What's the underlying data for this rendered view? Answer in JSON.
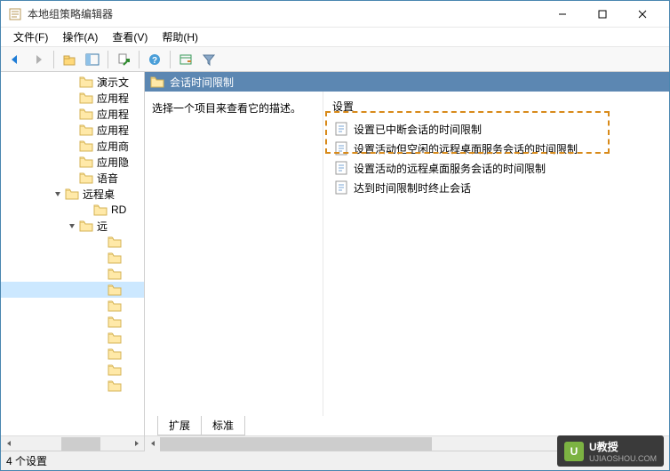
{
  "window": {
    "title": "本地组策略编辑器"
  },
  "menu": {
    "file": "文件(F)",
    "action": "操作(A)",
    "view": "查看(V)",
    "help": "帮助(H)"
  },
  "tree": {
    "items": [
      {
        "label": "演示文",
        "indent": 72
      },
      {
        "label": "应用程",
        "indent": 72
      },
      {
        "label": "应用程",
        "indent": 72
      },
      {
        "label": "应用程",
        "indent": 72
      },
      {
        "label": "应用商",
        "indent": 72
      },
      {
        "label": "应用隐",
        "indent": 72
      },
      {
        "label": "语音",
        "indent": 72
      },
      {
        "label": "远程桌",
        "indent": 56,
        "expander": "open"
      },
      {
        "label": "RD",
        "indent": 88
      },
      {
        "label": "远",
        "indent": 72,
        "expander": "open"
      },
      {
        "label": "",
        "indent": 104
      },
      {
        "label": "",
        "indent": 104
      },
      {
        "label": "",
        "indent": 104
      },
      {
        "label": "",
        "indent": 104,
        "selected": true
      },
      {
        "label": "",
        "indent": 104
      },
      {
        "label": "",
        "indent": 104
      },
      {
        "label": "",
        "indent": 104
      },
      {
        "label": "",
        "indent": 104
      },
      {
        "label": "",
        "indent": 104
      },
      {
        "label": "",
        "indent": 104
      }
    ]
  },
  "right": {
    "header": "会话时间限制",
    "desc": "选择一个项目来查看它的描述。",
    "settings_header": "设置",
    "settings": [
      "设置已中断会话的时间限制",
      "设置活动但空闲的远程桌面服务会话的时间限制",
      "设置活动的远程桌面服务会话的时间限制",
      "达到时间限制时终止会话"
    ]
  },
  "tabs": {
    "extended": "扩展",
    "standard": "标准"
  },
  "status": "4 个设置",
  "watermark": {
    "brand": "U教授",
    "url": "UJIAOSHOU.COM"
  }
}
